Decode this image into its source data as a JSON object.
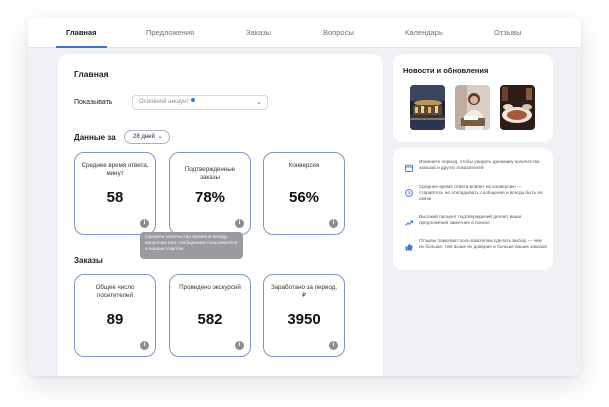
{
  "nav": {
    "tabs": [
      {
        "label": "Главная",
        "active": true
      },
      {
        "label": "Предложения",
        "active": false
      },
      {
        "label": "Заказы",
        "active": false
      },
      {
        "label": "Вопросы",
        "active": false
      },
      {
        "label": "Календарь",
        "active": false
      },
      {
        "label": "Отзывы",
        "active": false
      }
    ]
  },
  "main": {
    "title": "Главная",
    "show_label": "Показывать",
    "account_select": "Основной аккаунт",
    "data_label": "Данные за",
    "period_select": "28 дней",
    "stats": [
      {
        "label": "Среднее время ответа, минут",
        "value": "58"
      },
      {
        "label": "Подтвержденные заказы",
        "value": "78%"
      },
      {
        "label": "Конверсия",
        "value": "56%"
      }
    ],
    "tooltip": "Среднее количество времени между вопросом или сообщением пользователя и вашим ответом",
    "orders_title": "Заказы",
    "orders": [
      {
        "label": "Общее число посетителей",
        "value": "89"
      },
      {
        "label": "Проведено экскурсий",
        "value": "582"
      },
      {
        "label": "Заработано за период, ₽",
        "value": "3950"
      }
    ]
  },
  "news": {
    "title": "Новости и обновления"
  },
  "tips": [
    {
      "icon": "calendar-icon",
      "text": "Измените период, чтобы увидеть динамику количества заказов и других показателей"
    },
    {
      "icon": "clock-icon",
      "text": "Среднее время ответа влияет на конверсию — старайтесь не откладывать сообщения и всегда быть на связи"
    },
    {
      "icon": "trend-up-icon",
      "text": "Высокий процент подтверждений делает ваши предложения заметнее в поиске"
    },
    {
      "icon": "thumbs-up-icon",
      "text": "Отзывы помогают пользователям сделать выбор — чем их больше, тем выше их доверие и больше ваших заказов"
    }
  ],
  "colors": {
    "accent": "#3d74db",
    "card_border": "#7d96c9",
    "background": "#f0f1f5"
  }
}
